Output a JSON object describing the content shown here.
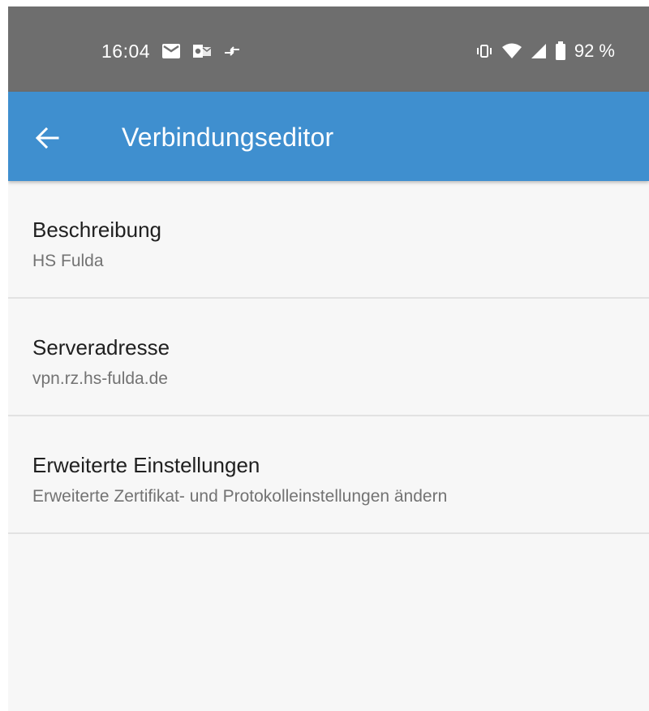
{
  "status_bar": {
    "time": "16:04",
    "battery_percent": "92 %",
    "icons": [
      "email-icon",
      "outlook-icon",
      "data-transfer-icon",
      "vibrate-icon",
      "wifi-icon",
      "cellular-signal-icon",
      "battery-icon"
    ]
  },
  "app_bar": {
    "title": "Verbindungseditor",
    "back_icon": "arrow-back-icon",
    "background_color": "#3f8fcf"
  },
  "settings": [
    {
      "title": "Beschreibung",
      "subtitle": "HS Fulda"
    },
    {
      "title": "Serveradresse",
      "subtitle": "vpn.rz.hs-fulda.de"
    },
    {
      "title": "Erweiterte Einstellungen",
      "subtitle": "Erweiterte Zertifikat- und Protokolleinstellungen ändern"
    }
  ]
}
